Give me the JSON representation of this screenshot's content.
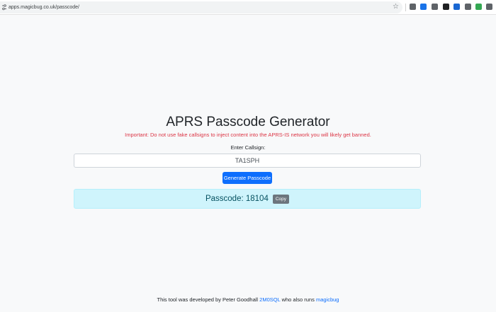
{
  "browser": {
    "url": "apps.magicbug.co.uk/passcode/",
    "icons": [
      "site-info-icon",
      "bookmark-star-icon"
    ],
    "extensions": [
      {
        "name": "extension-reading-list-icon",
        "color": "#5f6368"
      },
      {
        "name": "extension-globe-icon",
        "color": "#1a73e8"
      },
      {
        "name": "extension-download-icon",
        "color": "#5f6368"
      },
      {
        "name": "extension-pen-icon",
        "color": "#202124"
      },
      {
        "name": "extension-shield-icon",
        "color": "#1967d2"
      },
      {
        "name": "extension-document-icon",
        "color": "#5f6368"
      },
      {
        "name": "extension-refresh-icon",
        "color": "#34a853"
      },
      {
        "name": "extension-grid-icon",
        "color": "#5f6368"
      }
    ]
  },
  "page": {
    "title": "APRS Passcode Generator",
    "warning": "Important: Do not use fake callsigns to inject content into the APRS-IS network you will likely get banned.",
    "callsign_label": "Enter Callsign:",
    "callsign_value": "TA1SPH",
    "generate_label": "Generate Passcode",
    "passcode_text": "Passcode: 18104",
    "copy_label": "Copy"
  },
  "footer": {
    "prefix": "This tool was developed by Peter Goodhall ",
    "author_link": "2M0SQL",
    "middle": " who also runs ",
    "site_link": "magicbug"
  },
  "colors": {
    "background": "#f8f9fa",
    "warning": "#dc3545",
    "primary": "#0d6efd",
    "result_bg": "#cff4fc",
    "result_text": "#055160",
    "copy_bg": "#6c757d"
  }
}
